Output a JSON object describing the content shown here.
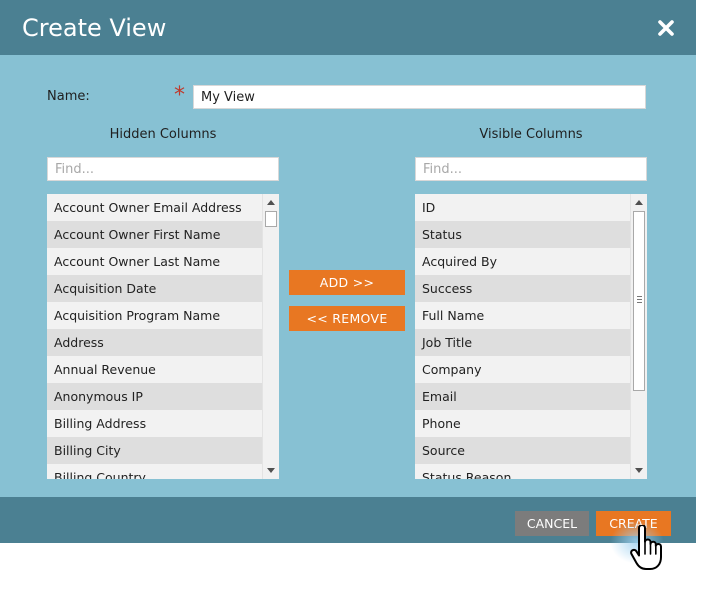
{
  "dialog": {
    "title": "Create View"
  },
  "form": {
    "name_label": "Name:",
    "required_mark": "*",
    "name_value": "My View"
  },
  "hidden_columns": {
    "heading": "Hidden Columns",
    "find_placeholder": "Find...",
    "items": [
      "Account Owner Email Address",
      "Account Owner First Name",
      "Account Owner Last Name",
      "Acquisition Date",
      "Acquisition Program Name",
      "Address",
      "Annual Revenue",
      "Anonymous IP",
      "Billing Address",
      "Billing City",
      "Billing Country"
    ]
  },
  "visible_columns": {
    "heading": "Visible Columns",
    "find_placeholder": "Find...",
    "items": [
      "ID",
      "Status",
      "Acquired By",
      "Success",
      "Full Name",
      "Job Title",
      "Company",
      "Email",
      "Phone",
      "Source",
      "Status Reason"
    ]
  },
  "actions": {
    "add_label": "ADD >>",
    "remove_label": "<< REMOVE",
    "cancel_label": "CANCEL",
    "create_label": "CREATE"
  },
  "colors": {
    "header_bg": "#4b8092",
    "body_bg": "#87c1d3",
    "accent_orange": "#e87722",
    "cancel_gray": "#7c7c7c"
  },
  "icons": {
    "close": "close-icon",
    "cursor": "hand-pointer-icon"
  }
}
